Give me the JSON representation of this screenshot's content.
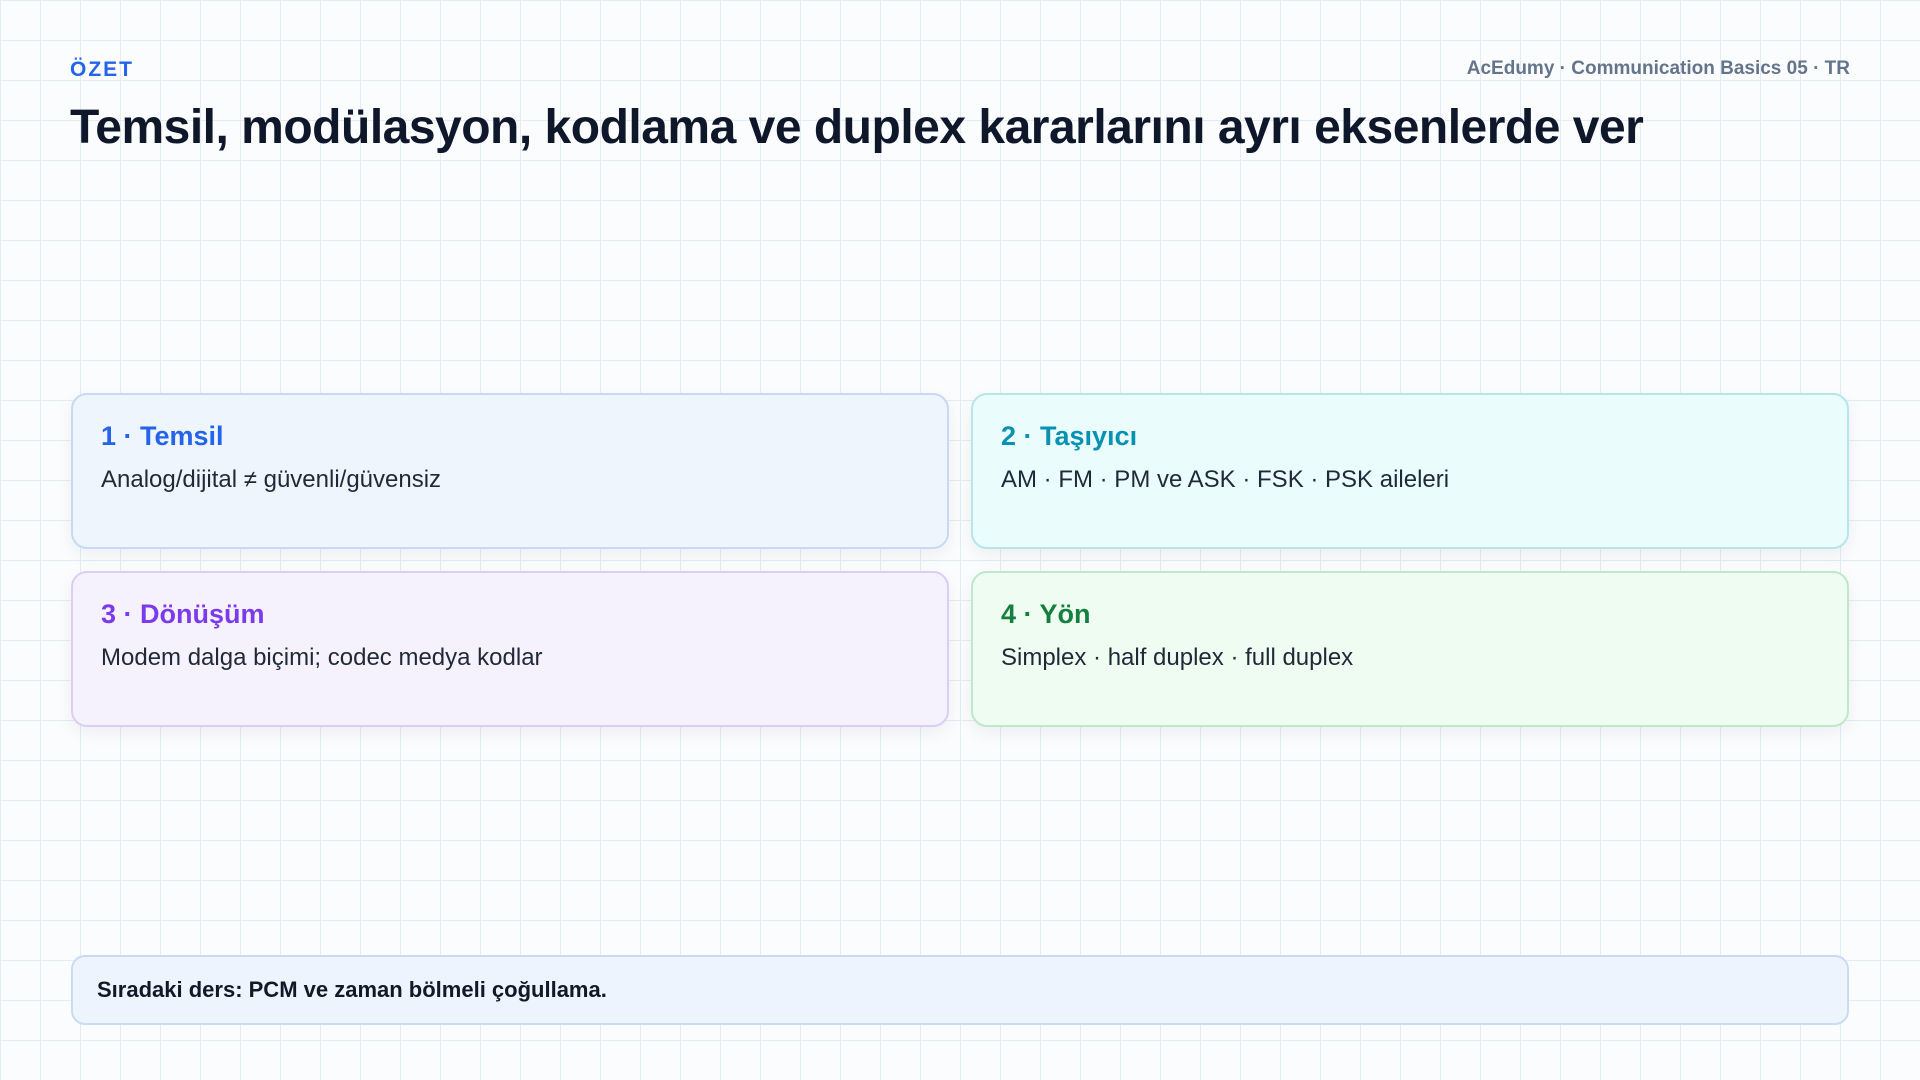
{
  "header": {
    "eyebrow": "ÖZET",
    "course": "AcEdumy · Communication Basics 05 · TR",
    "title": "Temsil, modülasyon, kodlama ve duplex kararlarını ayrı eksenlerde ver"
  },
  "cards": [
    {
      "title": "1 · Temsil",
      "text": "Analog/dijital ≠ güvenli/güvensiz",
      "accent": "#2563eb",
      "background": "#eff5fd",
      "border": "#c7d9f4"
    },
    {
      "title": "2 · Taşıyıcı",
      "text": "AM · FM · PM ve ASK · FSK · PSK aileleri",
      "accent": "#0891b2",
      "background": "#ebfcfd",
      "border": "#b4e6ec"
    },
    {
      "title": "3 · Dönüşüm",
      "text": "Modem dalga biçimi; codec medya kodlar",
      "accent": "#7c3aed",
      "background": "#f6f2fd",
      "border": "#dccdf5"
    },
    {
      "title": "4 · Yön",
      "text": "Simplex · half duplex · full duplex",
      "accent": "#15803d",
      "background": "#eefcf1",
      "border": "#bfe8c9"
    }
  ],
  "footer": {
    "text": "Sıradaki ders: PCM ve zaman bölmeli çoğullama."
  }
}
